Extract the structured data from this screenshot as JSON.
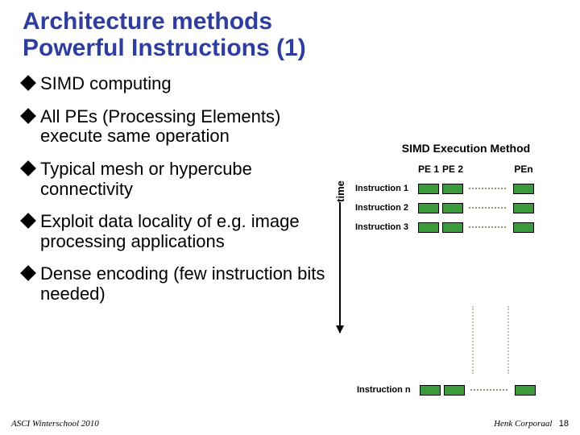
{
  "title_line1": "Architecture methods",
  "title_line2": "Powerful Instructions (1)",
  "bullets": [
    "SIMD computing",
    "All PEs (Processing Elements) execute same operation",
    "Typical mesh or hypercube connectivity",
    "Exploit data locality of e.g. image processing applications",
    "Dense encoding (few instruction bits needed)"
  ],
  "diagram": {
    "title": "SIMD Execution Method",
    "time_label": "time",
    "pe_headers": [
      "PE 1",
      "PE 2",
      "PEn"
    ],
    "instructions": [
      "Instruction 1",
      "Instruction 2",
      "Instruction 3"
    ],
    "instruction_n": "Instruction n"
  },
  "footer": {
    "left": "ASCI Winterschool 2010",
    "right": "Henk Corporaal",
    "page": "18"
  },
  "colors": {
    "accent": "#2f3e9e",
    "pe_box": "#3b9b3b"
  }
}
